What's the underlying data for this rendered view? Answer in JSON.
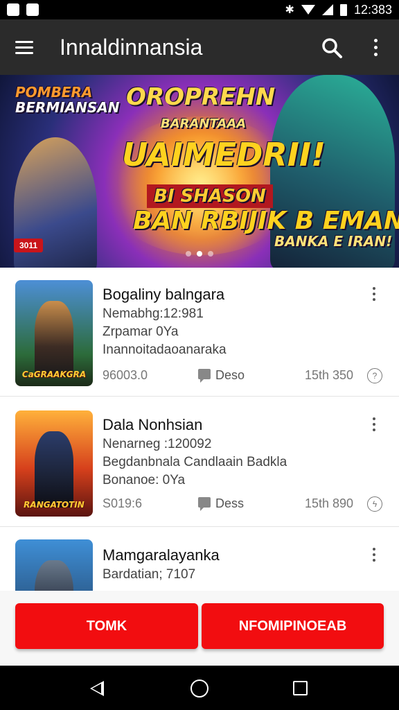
{
  "status_bar": {
    "time": "12:383"
  },
  "toolbar": {
    "title": "Innaldinnansia"
  },
  "banner": {
    "brand_line1": "POMBERA",
    "brand_line2": "BERMIANSAN",
    "brand_main": "OROPREHN",
    "sub1": "BARANTAAA",
    "headline": "UAIMEDRII!",
    "mid": "BI SHASON",
    "big": "BAN RBIJIK B EMANV!\"",
    "sub2": "BANKA E IRAN!",
    "badge": "3011"
  },
  "cards": [
    {
      "title": "Bogaliny balngara",
      "line1": "Nemabhg:12:981",
      "line2": "Zrpamar 0Ya",
      "line3": "Inannoitadaoanaraka",
      "meta_left": "96003.0",
      "meta_mid": "Deso",
      "meta_right": "15th 350",
      "thumb_caption": "CaGRAAKGRA"
    },
    {
      "title": "Dala Nonhsian",
      "line1": "Nenarneg :120092",
      "line2": "Begdanbnala Candlaain Badkla",
      "line3": "Bonanoe: 0Ya",
      "meta_left": "S019:6",
      "meta_mid": "Dess",
      "meta_right": "15th 890",
      "thumb_caption": "RANGATOTIN"
    },
    {
      "title": "Mamgaralayanka",
      "line1": "Bardatian; 7107",
      "line2": "",
      "line3": "",
      "meta_left": "",
      "meta_mid": "",
      "meta_right": "",
      "thumb_caption": ""
    }
  ],
  "actions": {
    "left_label": "TOMK",
    "right_label": "NFOMIPINOEAB"
  }
}
